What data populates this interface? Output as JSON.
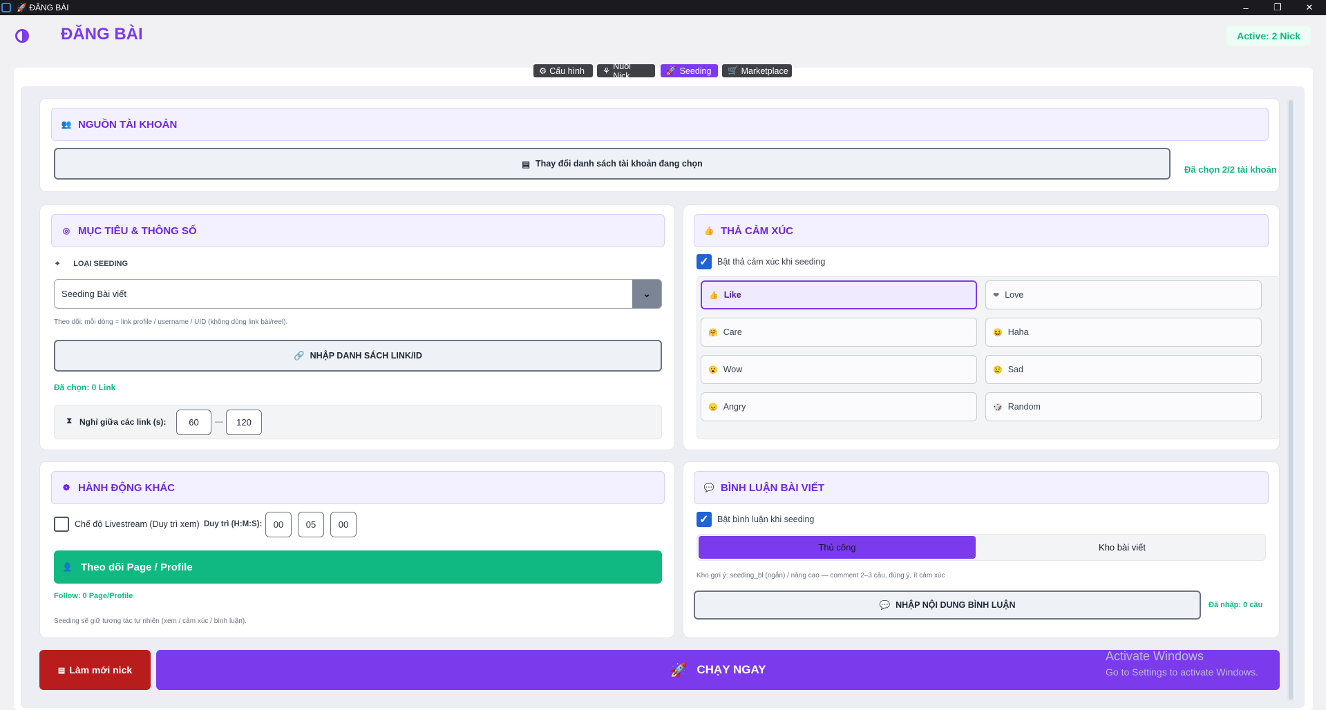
{
  "window": {
    "title": "🚀 ĐĂNG BÀI",
    "controls": [
      "–",
      "❐",
      "✕"
    ]
  },
  "header": {
    "title": "ĐĂNG BÀI",
    "active_badge": "Active: 2 Nick"
  },
  "tabs": [
    {
      "icon": "⚙",
      "label": "Cấu hình",
      "active": false
    },
    {
      "icon": "⚘",
      "label": "Nuôi Nick",
      "active": false
    },
    {
      "icon": "🚀",
      "label": "Seeding",
      "active": true
    },
    {
      "icon": "🛒",
      "label": "Marketplace",
      "active": false
    }
  ],
  "source": {
    "title": "NGUỒN TÀI KHOẢN",
    "change_button": "Thay đổi danh sách tài khoản đang chọn",
    "selected_status": "Đã chọn 2/2 tài khoản"
  },
  "targets": {
    "title": "MỤC TIÊU & THÔNG SỐ",
    "seeding_type_label": "LOẠI SEEDING",
    "seeding_type_value": "Seeding Bài viết",
    "hint": "Theo dõi: mỗi dòng = link profile / username / UID (không dùng link bài/reel).",
    "import_button": "NHẬP DANH SÁCH LINK/ID",
    "selected_links": "Đã chọn: 0 Link",
    "delay_label": "Nghỉ giữa các link (s):",
    "delay_min": "60",
    "delay_sep": "—",
    "delay_max": "120"
  },
  "reactions": {
    "title": "THẢ CẢM XÚC",
    "enable_label": "Bật thả cảm xúc khi seeding",
    "enabled": true,
    "items": [
      {
        "icon": "👍",
        "label": "Like",
        "selected": true
      },
      {
        "icon": "❤",
        "label": "Love",
        "selected": false
      },
      {
        "icon": "🤗",
        "label": "Care",
        "selected": false
      },
      {
        "icon": "😆",
        "label": "Haha",
        "selected": false
      },
      {
        "icon": "😮",
        "label": "Wow",
        "selected": false
      },
      {
        "icon": "😢",
        "label": "Sad",
        "selected": false
      },
      {
        "icon": "😠",
        "label": "Angry",
        "selected": false
      },
      {
        "icon": "🎲",
        "label": "Random",
        "selected": false
      }
    ]
  },
  "other_actions": {
    "title": "HÀNH ĐỘNG KHÁC",
    "livestream_label": "Chế độ Livestream (Duy trì xem)",
    "livestream_enabled": false,
    "duration_label": "Duy trì (H:M:S):",
    "hours": "00",
    "minutes": "05",
    "seconds": "00",
    "follow_button": "Theo dõi Page / Profile",
    "follow_status": "Follow: 0 Page/Profile",
    "footer_note": "Seeding sẽ giữ tương tác tự nhiên (xem / cảm xúc / bình luận)."
  },
  "comments": {
    "title": "BÌNH LUẬN BÀI VIẾT",
    "enable_label": "Bật bình luận khi seeding",
    "enabled": true,
    "modes": [
      {
        "label": "Thủ công",
        "active": true
      },
      {
        "label": "Kho bài viết",
        "active": false
      }
    ],
    "hint": "Kho gợi ý: seeding_bl (ngắn) / nâng cao — comment 2–3 câu, đúng ý, ít cảm xúc",
    "import_button": "NHẬP NỘI DUNG BÌNH LUẬN",
    "imported_status": "Đã nhập: 0 câu"
  },
  "footer": {
    "refresh_button": "Làm mới nick",
    "run_button": "CHẠY NGAY"
  },
  "watermark": {
    "title": "Activate Windows",
    "subtitle": "Go to Settings to activate Windows."
  }
}
